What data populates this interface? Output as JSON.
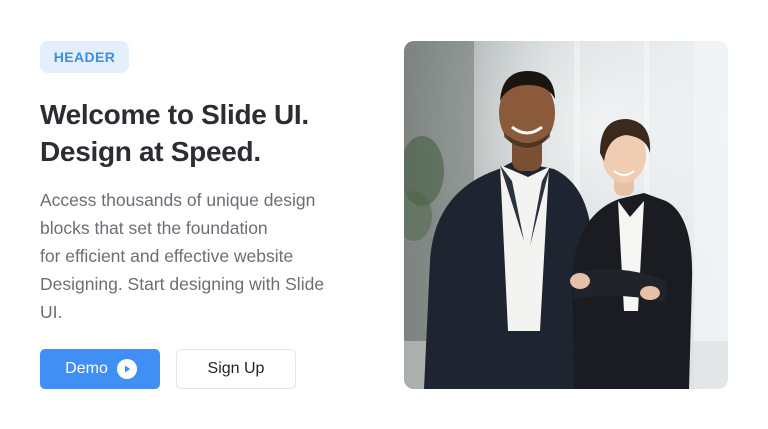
{
  "hero": {
    "badge": "HEADER",
    "title_lines": [
      "Welcome to Slide UI.",
      "Design at Speed."
    ],
    "description_lines": [
      "Access thousands of unique design",
      "blocks that set the foundation",
      "for efficient and effective website",
      "Designing. Start designing with Slide",
      "UI."
    ]
  },
  "buttons": {
    "demo_label": "Demo",
    "demo_icon": "play-circle-icon",
    "signup_label": "Sign Up"
  },
  "image": {
    "subject": "two-business-people-office-photo"
  },
  "colors": {
    "accent": "#3f8ff5",
    "badge_bg": "#e3f0fc",
    "badge_text": "#3b8fe6",
    "heading": "#2b2d33",
    "body_text": "#6b6e76"
  }
}
